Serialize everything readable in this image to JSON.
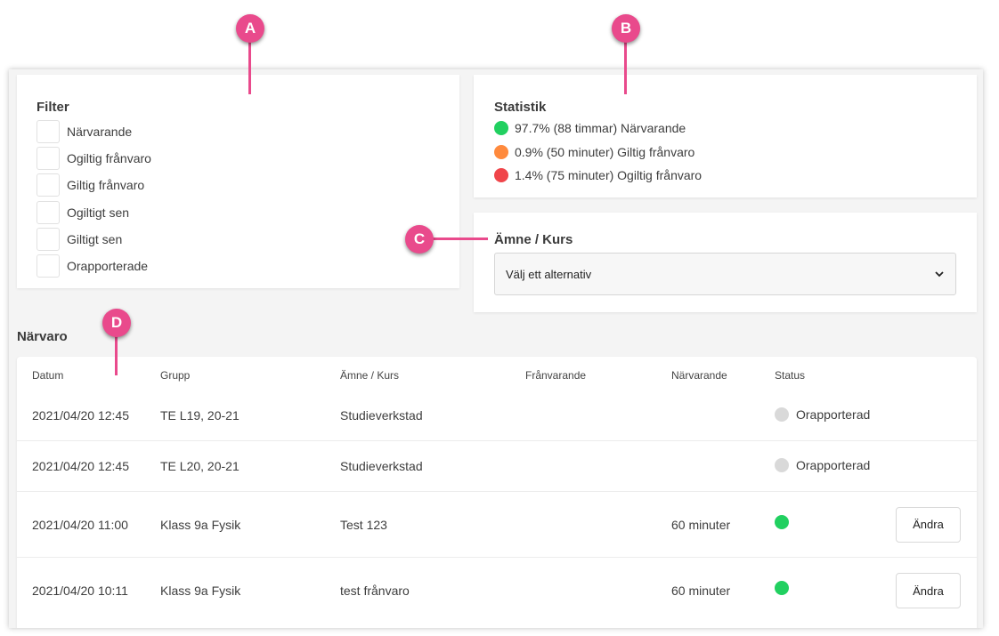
{
  "callouts": [
    "A",
    "B",
    "C",
    "D"
  ],
  "filter": {
    "title": "Filter",
    "items": [
      "Närvarande",
      "Ogiltig frånvaro",
      "Giltig frånvaro",
      "Ogiltigt sen",
      "Giltigt sen",
      "Orapporterade"
    ]
  },
  "stats": {
    "title": "Statistik",
    "items": [
      {
        "text": "97.7% (88 timmar) Närvarande",
        "color": "#21d060"
      },
      {
        "text": "0.9% (50 minuter) Giltig frånvaro",
        "color": "#ff8a3d"
      },
      {
        "text": "1.4% (75 minuter) Ogiltig frånvaro",
        "color": "#f0454a"
      }
    ]
  },
  "course": {
    "title": "Ämne / Kurs",
    "select_value": "Välj ett alternativ"
  },
  "attendance": {
    "title": "Närvaro",
    "columns": [
      "Datum",
      "Grupp",
      "Ämne / Kurs",
      "Frånvarande",
      "Närvarande",
      "Status"
    ],
    "rows": [
      {
        "date": "2021/04/20 12:45",
        "group": "TE L19, 20-21",
        "course": "Studieverkstad",
        "absent": "",
        "present": "",
        "status": "Orapporterad",
        "status_color": "#d9d9d9",
        "action": ""
      },
      {
        "date": "2021/04/20 12:45",
        "group": "TE L20, 20-21",
        "course": "Studieverkstad",
        "absent": "",
        "present": "",
        "status": "Orapporterad",
        "status_color": "#d9d9d9",
        "action": ""
      },
      {
        "date": "2021/04/20 11:00",
        "group": "Klass 9a Fysik",
        "course": "Test 123",
        "absent": "",
        "present": "60 minuter",
        "status": "",
        "status_color": "#21d060",
        "action": "Ändra"
      },
      {
        "date": "2021/04/20 10:11",
        "group": "Klass 9a Fysik",
        "course": "test frånvaro",
        "absent": "",
        "present": "60 minuter",
        "status": "",
        "status_color": "#21d060",
        "action": "Ändra"
      }
    ]
  },
  "colors": {
    "callout": "#e94a8c"
  }
}
